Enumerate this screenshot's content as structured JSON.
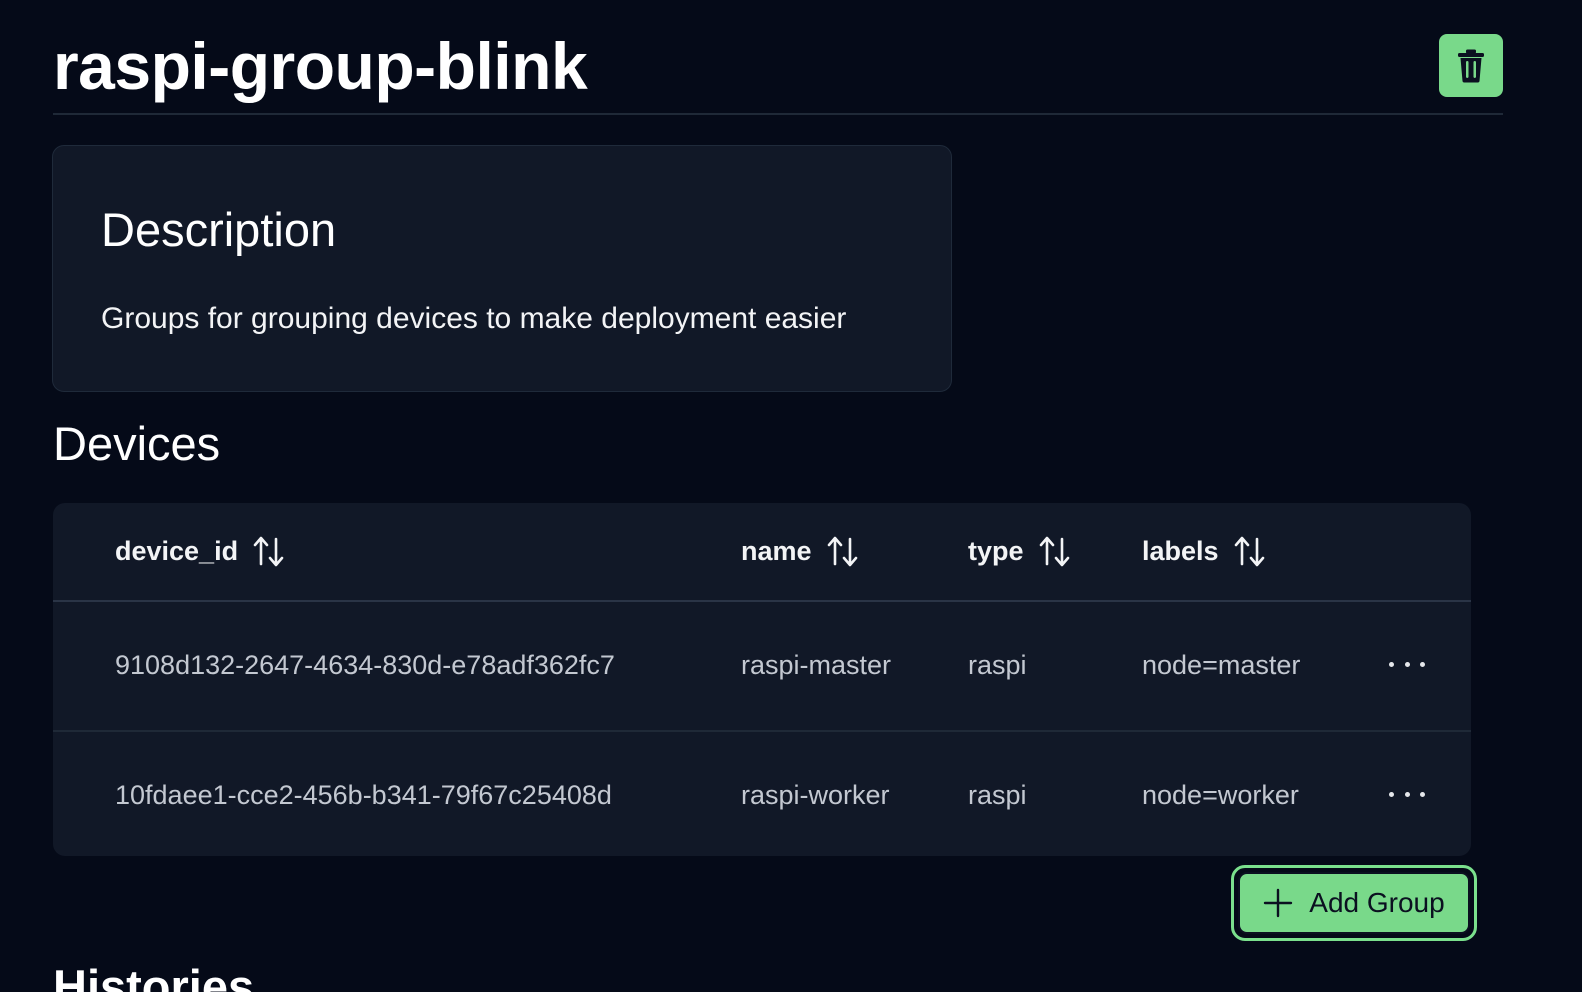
{
  "page": {
    "title": "raspi-group-blink"
  },
  "description": {
    "heading": "Description",
    "text": "Groups for grouping devices to make deployment easier"
  },
  "devices": {
    "heading": "Devices",
    "columns": [
      {
        "key": "device_id",
        "label": "device_id"
      },
      {
        "key": "name",
        "label": "name"
      },
      {
        "key": "type",
        "label": "type"
      },
      {
        "key": "labels",
        "label": "labels"
      }
    ],
    "rows": [
      {
        "device_id": "9108d132-2647-4634-830d-e78adf362fc7",
        "name": "raspi-master",
        "type": "raspi",
        "labels": "node=master"
      },
      {
        "device_id": "10fdaee1-cce2-456b-b341-79f67c25408d",
        "name": "raspi-worker",
        "type": "raspi",
        "labels": "node=worker"
      }
    ]
  },
  "actions": {
    "add_group_label": "Add Group"
  },
  "histories": {
    "heading": "Histories"
  },
  "colors": {
    "background": "#050a18",
    "card": "#111827",
    "accent_green": "#79d98a",
    "text_primary": "#ffffff",
    "text_muted": "#c3c8d1"
  },
  "icons": {
    "delete": "trash-icon",
    "sort": "sort-arrows-icon",
    "row_menu": "ellipsis-icon",
    "add": "plus-icon"
  }
}
